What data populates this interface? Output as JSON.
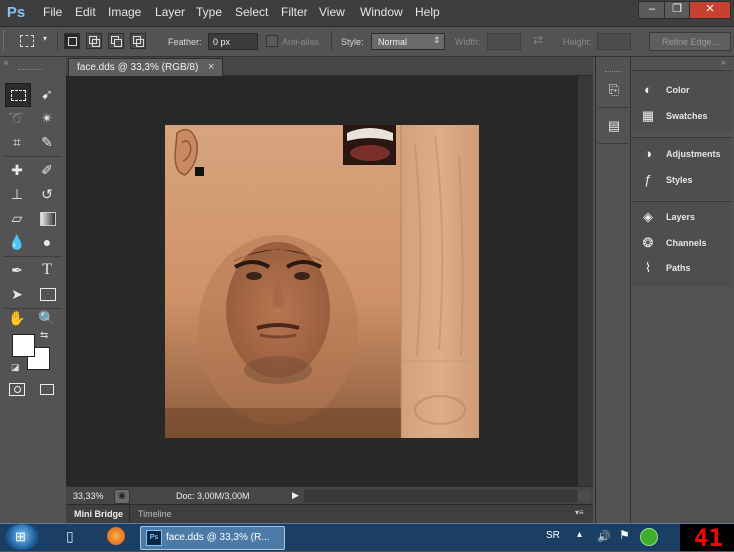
{
  "menu": {
    "logo": "Ps",
    "items": [
      "File",
      "Edit",
      "Image",
      "Layer",
      "Type",
      "Select",
      "Filter",
      "View",
      "Window",
      "Help"
    ],
    "window_controls": {
      "minimize": "–",
      "restore": "❐",
      "close": "✕"
    }
  },
  "options": {
    "feather_label": "Feather:",
    "feather_value": "0 px",
    "antialias_label": "Anti-alias",
    "style_label": "Style:",
    "style_value": "Normal",
    "width_label": "Width:",
    "height_label": "Height:",
    "refine_edge": "Refine Edge..."
  },
  "document": {
    "tab_title": "face.dds @ 33,3% (RGB/8)",
    "tab_close": "×"
  },
  "status": {
    "zoom": "33,33%",
    "doc_info": "Doc: 3,00M/3,00M"
  },
  "bottom_tabs": [
    "Mini Bridge",
    "Timeline"
  ],
  "panels": {
    "group1": [
      "Color",
      "Swatches"
    ],
    "group2": [
      "Adjustments",
      "Styles"
    ],
    "group3": [
      "Layers",
      "Channels",
      "Paths"
    ]
  },
  "icons": {
    "toolbox": [
      "rectangular-marquee",
      "move",
      "lasso",
      "magic-wand",
      "crop",
      "eyedropper",
      "spot-healing",
      "brush",
      "clone-stamp",
      "history-brush",
      "eraser",
      "gradient",
      "blur",
      "dodge",
      "pen",
      "type",
      "path-selection",
      "rectangle",
      "hand",
      "zoom",
      "swap-colors",
      "default-colors",
      "quick-mask",
      "screen-mode"
    ],
    "panels": [
      "color-icon",
      "swatches-icon",
      "adjustments-icon",
      "styles-icon",
      "layers-icon",
      "channels-icon",
      "paths-icon"
    ]
  },
  "colors": {
    "foreground": "#ffffff",
    "background": "#ffffff",
    "counter": "#ff0000"
  },
  "taskbar": {
    "active_window": "face.dds @ 33,3% (R...",
    "language": "SR",
    "counter": "41"
  }
}
